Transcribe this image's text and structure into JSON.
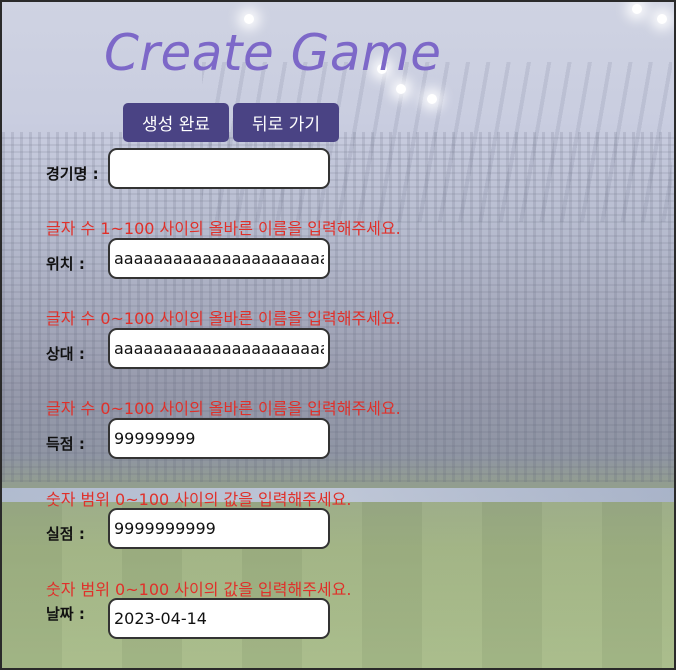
{
  "title": "Create Game",
  "buttons": {
    "create": "생성 완료",
    "back": "뒤로 가기"
  },
  "form": {
    "name": {
      "label": "경기명 :",
      "value": "",
      "error": "글자 수 1~100 사이의 올바른 이름을 입력해주세요."
    },
    "location": {
      "label": "위치 :",
      "value": "aaaaaaaaaaaaaaaaaaaaaaaa",
      "error": "글자 수 0~100 사이의 올바른 이름을 입력해주세요."
    },
    "opponent": {
      "label": "상대 :",
      "value": "aaaaaaaaaaaaaaaaaaaaaaaa",
      "error": "글자 수 0~100 사이의 올바른 이름을 입력해주세요."
    },
    "score": {
      "label": "득점 :",
      "value": "99999999",
      "error": "숫자 범위 0~100 사이의 값을 입력해주세요."
    },
    "conceded": {
      "label": "실점 :",
      "value": "9999999999",
      "error": "숫자 범위 0~100 사이의 값을 입력해주세요."
    },
    "date": {
      "label": "날짜 :",
      "value": "2023-04-14"
    }
  }
}
